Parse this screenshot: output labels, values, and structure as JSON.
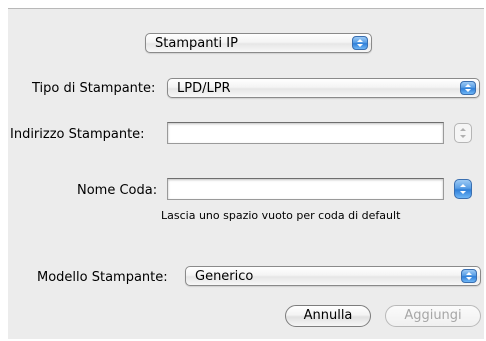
{
  "connection_type": {
    "selected": "Stampanti IP"
  },
  "printer_type": {
    "label": "Tipo di Stampante:",
    "selected": "LPD/LPR"
  },
  "printer_address": {
    "label": "Indirizzo Stampante:",
    "value": ""
  },
  "queue_name": {
    "label": "Nome Coda:",
    "value": "",
    "hint": "Lascia uno spazio vuoto per coda di default"
  },
  "printer_model": {
    "label": "Modello Stampante:",
    "selected": "Generico"
  },
  "buttons": {
    "cancel": "Annulla",
    "add": "Aggiungi"
  },
  "colors": {
    "accent": "#3d8ae3",
    "sheet_bg": "#ececec"
  }
}
